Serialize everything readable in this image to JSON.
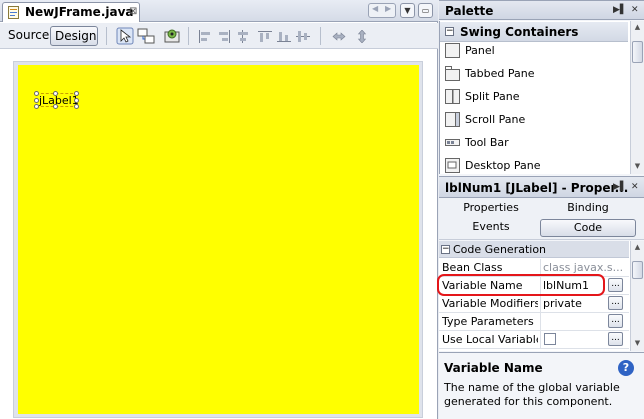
{
  "editor": {
    "file_tab": "NewJFrame.java",
    "close_glyph": "⊠",
    "view_source": "Source",
    "view_design": "Design",
    "component_label": "jLabel1"
  },
  "palette": {
    "title": "Palette",
    "category": "Swing Containers",
    "items": [
      "Panel",
      "Tabbed Pane",
      "Split Pane",
      "Scroll Pane",
      "Tool Bar",
      "Desktop Pane"
    ]
  },
  "properties": {
    "title": "lblNum1 [JLabel] - Proper...",
    "tabs": [
      "Properties",
      "Binding",
      "Events",
      "Code"
    ],
    "active_tab": "Code",
    "section": "Code Generation",
    "rows": [
      {
        "name": "Bean Class",
        "value": "class javax.s..."
      },
      {
        "name": "Variable Name",
        "value": "lblNum1"
      },
      {
        "name": "Variable Modifiers",
        "value": "private"
      },
      {
        "name": "Type Parameters",
        "value": ""
      },
      {
        "name": "Use Local Variable",
        "value": ""
      }
    ],
    "ellipsis": "..."
  },
  "help": {
    "title": "Variable Name",
    "text": "The name of the global variable generated for this component.",
    "icon_text": "?"
  },
  "colors": {
    "frame_bg": "#ffff00",
    "highlight": "#e4161a",
    "help_icon": "#2f63c4"
  }
}
